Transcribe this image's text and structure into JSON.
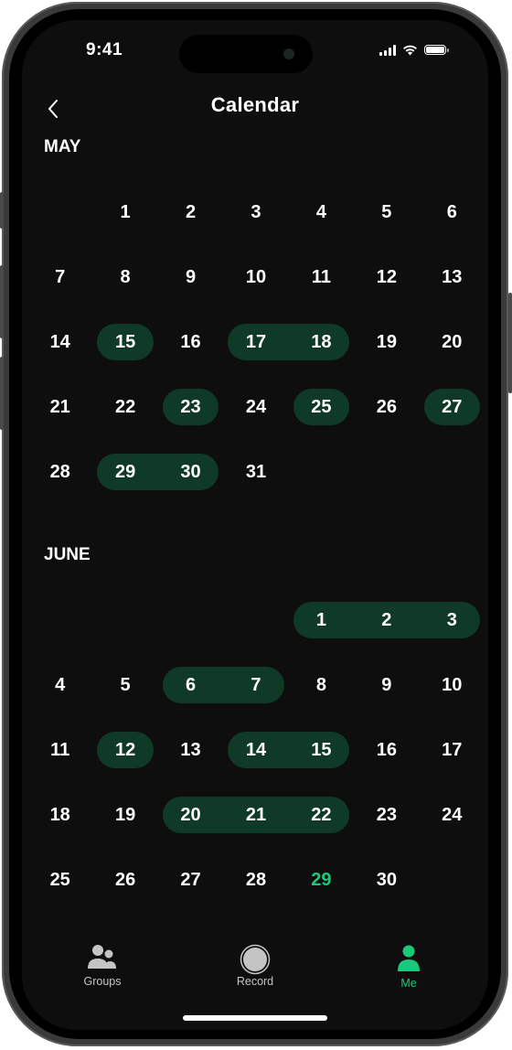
{
  "status_bar": {
    "time": "9:41"
  },
  "header": {
    "title": "Calendar",
    "back_icon": "chevron-left-icon"
  },
  "colors": {
    "background": "#0e0e0e",
    "highlight": "#0f3a27",
    "accent": "#19c97c",
    "text": "#ffffff",
    "tab_inactive": "#c4c4c4"
  },
  "months": [
    {
      "name": "MAY",
      "weeks": [
        [
          "",
          "1",
          "2",
          "3",
          "4",
          "5",
          "6"
        ],
        [
          "7",
          "8",
          "9",
          "10",
          "11",
          "12",
          "13"
        ],
        [
          "14",
          "15",
          "16",
          "17",
          "18",
          "19",
          "20"
        ],
        [
          "21",
          "22",
          "23",
          "24",
          "25",
          "26",
          "27"
        ],
        [
          "28",
          "29",
          "30",
          "31",
          "",
          "",
          ""
        ]
      ],
      "highlighted_ranges": [
        {
          "week": 2,
          "from_col": 1,
          "to_col": 1
        },
        {
          "week": 2,
          "from_col": 3,
          "to_col": 4
        },
        {
          "week": 3,
          "from_col": 2,
          "to_col": 2
        },
        {
          "week": 3,
          "from_col": 4,
          "to_col": 4
        },
        {
          "week": 3,
          "from_col": 6,
          "to_col": 6
        },
        {
          "week": 4,
          "from_col": 1,
          "to_col": 2
        }
      ],
      "today": null
    },
    {
      "name": "JUNE",
      "weeks": [
        [
          "",
          "",
          "",
          "",
          "1",
          "2",
          "3"
        ],
        [
          "4",
          "5",
          "6",
          "7",
          "8",
          "9",
          "10"
        ],
        [
          "11",
          "12",
          "13",
          "14",
          "15",
          "16",
          "17"
        ],
        [
          "18",
          "19",
          "20",
          "21",
          "22",
          "23",
          "24"
        ],
        [
          "25",
          "26",
          "27",
          "28",
          "29",
          "30",
          ""
        ]
      ],
      "highlighted_ranges": [
        {
          "week": 0,
          "from_col": 4,
          "to_col": 6
        },
        {
          "week": 1,
          "from_col": 2,
          "to_col": 3
        },
        {
          "week": 2,
          "from_col": 1,
          "to_col": 1
        },
        {
          "week": 2,
          "from_col": 3,
          "to_col": 4
        },
        {
          "week": 3,
          "from_col": 2,
          "to_col": 4
        }
      ],
      "today": "29"
    }
  ],
  "tab_bar": {
    "tabs": [
      {
        "label": "Groups",
        "icon": "groups-icon",
        "active": false
      },
      {
        "label": "Record",
        "icon": "record-icon",
        "active": false
      },
      {
        "label": "Me",
        "icon": "person-icon",
        "active": true
      }
    ]
  }
}
